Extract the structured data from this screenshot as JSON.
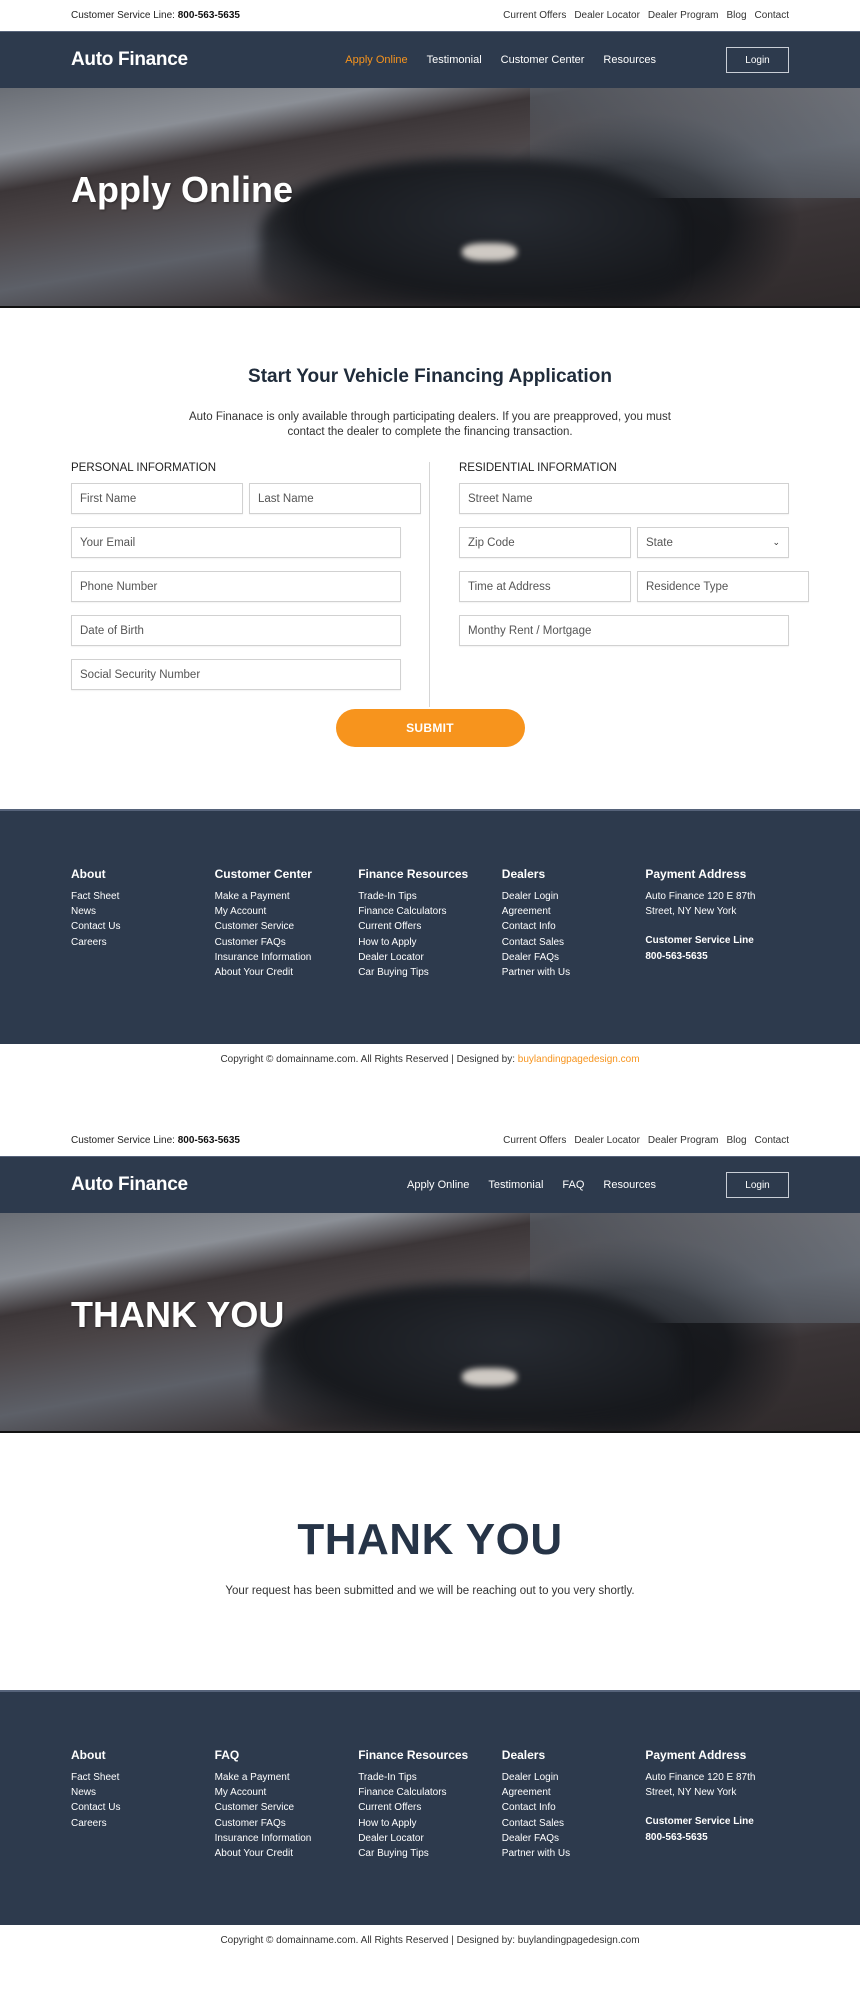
{
  "colors": {
    "navy": "#2d3a4d",
    "accent": "#f7941d",
    "heading": "#202c3b"
  },
  "page1": {
    "topbar": {
      "service_label": "Customer Service Line:",
      "phone": "800-563-5635",
      "links": [
        "Current Offers",
        "Dealer Locator",
        "Dealer Program",
        "Blog",
        "Contact"
      ]
    },
    "nav": {
      "logo": "Auto Finance",
      "items": [
        "Apply Online",
        "Testimonial",
        "Customer Center",
        "Resources"
      ],
      "active_index": 0,
      "login": "Login"
    },
    "hero": {
      "title": "Apply Online"
    },
    "form": {
      "title": "Start Your Vehicle Financing Application",
      "intro": "Auto Finanace is only available through participating dealers. If you are preapproved, you must contact the dealer to complete the financing transaction.",
      "personal": {
        "heading": "PERSONAL INFORMATION",
        "first_name": "First Name",
        "last_name": "Last Name",
        "email": "Your Email",
        "phone": "Phone Number",
        "dob": "Date of Birth",
        "ssn": "Social Security Number"
      },
      "residential": {
        "heading": "RESIDENTIAL INFORMATION",
        "street": "Street Name",
        "zip": "Zip Code",
        "state": "State",
        "time_at_address": "Time at Address",
        "residence_type": "Residence Type",
        "rent": "Monthy Rent / Mortgage"
      },
      "submit": "SUBMIT"
    },
    "footer": {
      "about": {
        "title": "About",
        "links": [
          "Fact Sheet",
          "News",
          "Contact Us",
          "Careers"
        ]
      },
      "center": {
        "title": "Customer Center",
        "links": [
          "Make a Payment",
          "My Account",
          "Customer Service",
          "Customer FAQs",
          "Insurance Information",
          "About Your Credit"
        ]
      },
      "resources": {
        "title": "Finance Resources",
        "links": [
          "Trade-In Tips",
          "Finance Calculators",
          "Current Offers",
          "How to Apply",
          "Dealer Locator",
          "Car Buying Tips"
        ]
      },
      "dealers": {
        "title": "Dealers",
        "links": [
          "Dealer Login",
          "Agreement",
          "Contact Info",
          "Contact Sales",
          "Dealer FAQs",
          "Partner with Us"
        ]
      },
      "payment": {
        "title": "Payment Address",
        "line1": "Auto Finance 120 E 87th",
        "line2": "Street, NY New York",
        "service_label": "Customer Service Line",
        "phone": "800-563-5635"
      }
    },
    "copyright": {
      "text": "Copyright © domainname.com. All Rights Reserved | Designed by: ",
      "designer": "buylandingpagedesign.com"
    }
  },
  "page2": {
    "topbar": {
      "service_label": "Customer Service Line:",
      "phone": "800-563-5635",
      "links": [
        "Current Offers",
        "Dealer Locator",
        "Dealer Program",
        "Blog",
        "Contact"
      ]
    },
    "nav": {
      "logo": "Auto Finance",
      "items": [
        "Apply Online",
        "Testimonial",
        "FAQ",
        "Resources"
      ],
      "login": "Login"
    },
    "hero": {
      "title": "THANK YOU"
    },
    "thankyou": {
      "title": "THANK YOU",
      "message": "Your request has been submitted and we will be reaching out to you very shortly."
    },
    "footer": {
      "about": {
        "title": "About",
        "links": [
          "Fact Sheet",
          "News",
          "Contact Us",
          "Careers"
        ]
      },
      "center": {
        "title": "FAQ",
        "links": [
          "Make a Payment",
          "My Account",
          "Customer Service",
          "Customer FAQs",
          "Insurance Information",
          "About Your Credit"
        ]
      },
      "resources": {
        "title": "Finance Resources",
        "links": [
          "Trade-In Tips",
          "Finance Calculators",
          "Current Offers",
          "How to Apply",
          "Dealer Locator",
          "Car Buying Tips"
        ]
      },
      "dealers": {
        "title": "Dealers",
        "links": [
          "Dealer Login",
          "Agreement",
          "Contact Info",
          "Contact Sales",
          "Dealer FAQs",
          "Partner with Us"
        ]
      },
      "payment": {
        "title": "Payment Address",
        "line1": "Auto Finance 120 E 87th",
        "line2": "Street, NY New York",
        "service_label": "Customer Service Line",
        "phone": "800-563-5635"
      }
    },
    "copyright": {
      "text": "Copyright © domainname.com. All Rights Reserved | Designed by: ",
      "designer": "buylandingpagedesign.com"
    }
  }
}
